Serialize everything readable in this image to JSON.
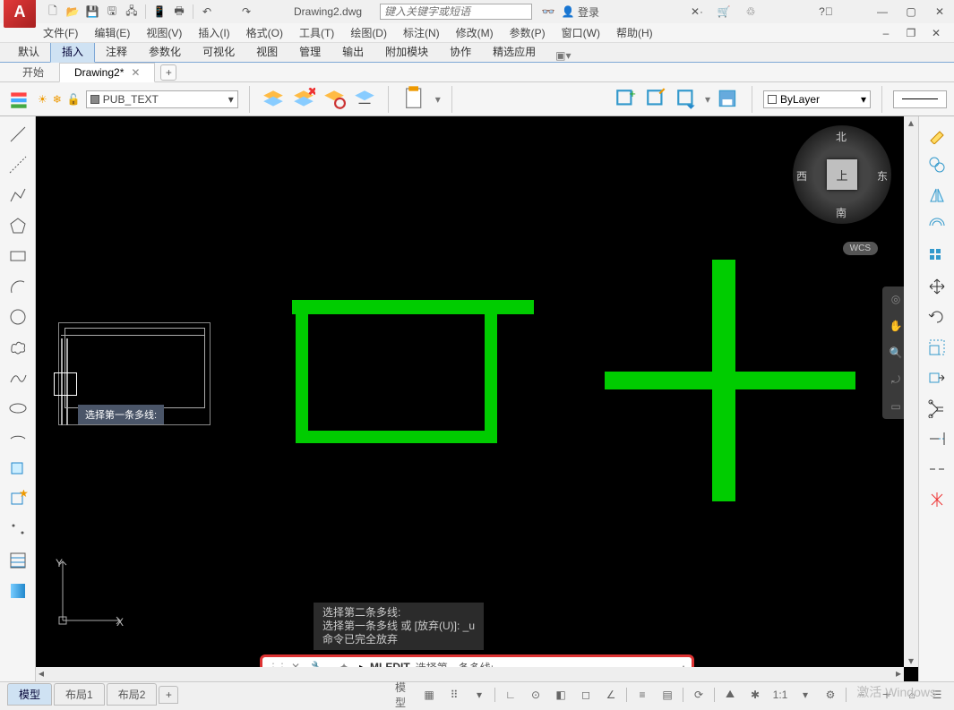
{
  "app": {
    "logo_letter": "A",
    "filename": "Drawing2.dwg",
    "search_placeholder": "键入关键字或短语",
    "login": "登录"
  },
  "menus": [
    "文件(F)",
    "编辑(E)",
    "视图(V)",
    "插入(I)",
    "格式(O)",
    "工具(T)",
    "绘图(D)",
    "标注(N)",
    "修改(M)",
    "参数(P)",
    "窗口(W)",
    "帮助(H)"
  ],
  "ribbon_tabs": [
    "默认",
    "插入",
    "注释",
    "参数化",
    "可视化",
    "视图",
    "管理",
    "输出",
    "附加模块",
    "协作",
    "精选应用"
  ],
  "ribbon_active": 1,
  "doc_tabs": {
    "start": "开始",
    "active": "Drawing2*"
  },
  "layer": {
    "name": "PUB_TEXT",
    "bylayer": "ByLayer"
  },
  "viewcube": {
    "face": "上",
    "n": "北",
    "s": "南",
    "e": "东",
    "w": "西",
    "wcs": "WCS"
  },
  "tooltip": "选择第一条多线:",
  "cmd_history": [
    "选择第二条多线:",
    "选择第一条多线 或 [放弃(U)]:  _u",
    "命令已完全放弃"
  ],
  "cmdline": {
    "cmd": "MLEDIT",
    "prompt": "选择第一条多线:"
  },
  "layout_tabs": [
    "模型",
    "布局1",
    "布局2"
  ],
  "status": {
    "model": "模型",
    "scale": "1:1"
  },
  "ucs": {
    "x": "X",
    "y": "Y"
  },
  "watermark": "激活 Windows"
}
